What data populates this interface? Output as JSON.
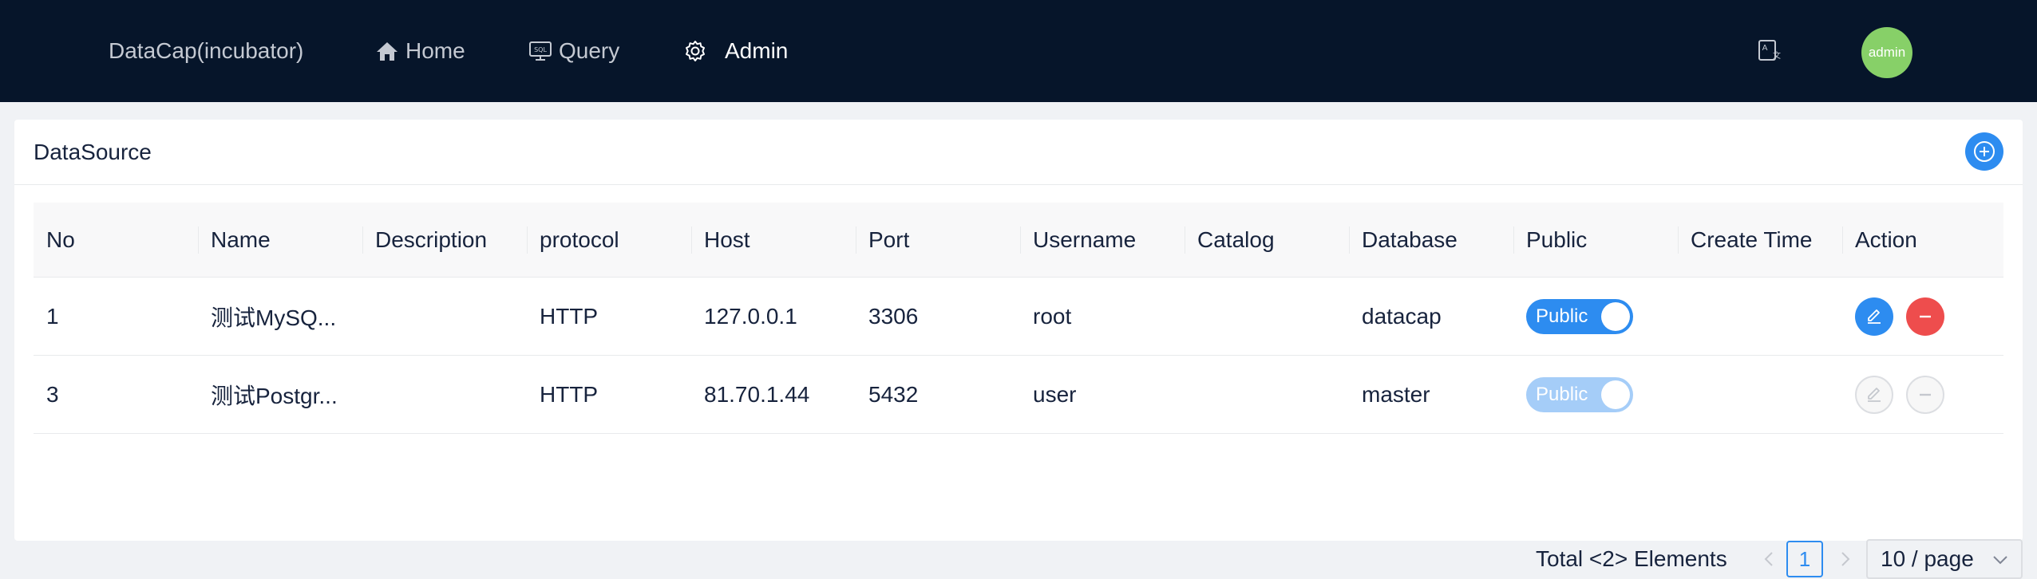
{
  "header": {
    "brand": "DataCap(incubator)",
    "nav": [
      {
        "label": "Home",
        "icon": "home-icon"
      },
      {
        "label": "Query",
        "icon": "sql-icon"
      },
      {
        "label": "Admin",
        "icon": "gear-icon",
        "active": true
      }
    ],
    "language_icon": "translate-icon",
    "avatar_text": "admin"
  },
  "card": {
    "title": "DataSource",
    "add_icon": "plus-circle-icon"
  },
  "table": {
    "columns": [
      "No",
      "Name",
      "Description",
      "protocol",
      "Host",
      "Port",
      "Username",
      "Catalog",
      "Database",
      "Public",
      "Create Time",
      "Action"
    ],
    "rows": [
      {
        "no": "1",
        "name": "测试MySQ...",
        "description": "",
        "protocol": "HTTP",
        "host": "127.0.0.1",
        "port": "3306",
        "username": "root",
        "catalog": "",
        "database": "datacap",
        "public_label": "Public",
        "public_on": true,
        "disabled": false,
        "create_time": ""
      },
      {
        "no": "3",
        "name": "测试Postgr...",
        "description": "",
        "protocol": "HTTP",
        "host": "81.70.1.44",
        "port": "5432",
        "username": "user",
        "catalog": "",
        "database": "master",
        "public_label": "Public",
        "public_on": true,
        "disabled": true,
        "create_time": ""
      }
    ]
  },
  "pagination": {
    "total_text": "Total <2> Elements",
    "current_page": "1",
    "page_size": "10 / page"
  },
  "colors": {
    "header_bg": "#06152a",
    "primary": "#2d8cf0",
    "danger": "#ee4d4d",
    "avatar": "#87d068"
  }
}
